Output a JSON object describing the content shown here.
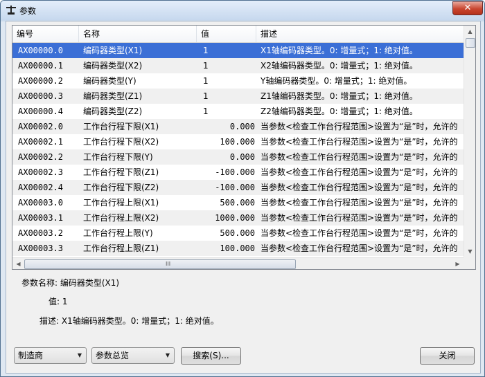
{
  "window": {
    "title": "参数",
    "close_glyph": "✕"
  },
  "table": {
    "columns": [
      "编号",
      "名称",
      "值",
      "描述"
    ],
    "rows": [
      {
        "code": "AX00000.0",
        "name": "编码器类型(X1)",
        "value": "1",
        "desc": "X1轴编码器类型。0: 增量式；1: 绝对值。",
        "align": "left",
        "state": "selected"
      },
      {
        "code": "AX00000.1",
        "name": "编码器类型(X2)",
        "value": "1",
        "desc": "X2轴编码器类型。0: 增量式；1: 绝对值。",
        "align": "left",
        "state": "normal"
      },
      {
        "code": "AX00000.2",
        "name": "编码器类型(Y)",
        "value": "1",
        "desc": "Y轴编码器类型。0: 增量式；1: 绝对值。",
        "align": "left",
        "state": "normal"
      },
      {
        "code": "AX00000.3",
        "name": "编码器类型(Z1)",
        "value": "1",
        "desc": "Z1轴编码器类型。0: 增量式；1: 绝对值。",
        "align": "left",
        "state": "normal"
      },
      {
        "code": "AX00000.4",
        "name": "编码器类型(Z2)",
        "value": "1",
        "desc": "Z2轴编码器类型。0: 增量式；1: 绝对值。",
        "align": "left",
        "state": "normal"
      },
      {
        "code": "AX00002.0",
        "name": "工作台行程下限(X1)",
        "value": "0.000",
        "desc": "当参数<检查工作台行程范围>设置为“是”时，允许的",
        "align": "right",
        "state": "normal"
      },
      {
        "code": "AX00002.1",
        "name": "工作台行程下限(X2)",
        "value": "100.000",
        "desc": "当参数<检查工作台行程范围>设置为“是”时，允许的",
        "align": "right",
        "state": "normal"
      },
      {
        "code": "AX00002.2",
        "name": "工作台行程下限(Y)",
        "value": "0.000",
        "desc": "当参数<检查工作台行程范围>设置为“是”时，允许的",
        "align": "right",
        "state": "normal"
      },
      {
        "code": "AX00002.3",
        "name": "工作台行程下限(Z1)",
        "value": "-100.000",
        "desc": "当参数<检查工作台行程范围>设置为“是”时，允许的",
        "align": "right",
        "state": "normal"
      },
      {
        "code": "AX00002.4",
        "name": "工作台行程下限(Z2)",
        "value": "-100.000",
        "desc": "当参数<检查工作台行程范围>设置为“是”时，允许的",
        "align": "right",
        "state": "normal"
      },
      {
        "code": "AX00003.0",
        "name": "工作台行程上限(X1)",
        "value": "500.000",
        "desc": "当参数<检查工作台行程范围>设置为“是”时，允许的",
        "align": "right",
        "state": "normal"
      },
      {
        "code": "AX00003.1",
        "name": "工作台行程上限(X2)",
        "value": "1000.000",
        "desc": "当参数<检查工作台行程范围>设置为“是”时，允许的",
        "align": "right",
        "state": "normal"
      },
      {
        "code": "AX00003.2",
        "name": "工作台行程上限(Y)",
        "value": "500.000",
        "desc": "当参数<检查工作台行程范围>设置为“是”时，允许的",
        "align": "right",
        "state": "normal"
      },
      {
        "code": "AX00003.3",
        "name": "工作台行程上限(Z1)",
        "value": "100.000",
        "desc": "当参数<检查工作台行程范围>设置为“是”时，允许的",
        "align": "right",
        "state": "normal"
      }
    ]
  },
  "scrollbar": {
    "grip_glyph": "III",
    "up_glyph": "▲",
    "down_glyph": "▼",
    "left_glyph": "◀",
    "right_glyph": "▶"
  },
  "detail": {
    "name_label": "参数名称:",
    "name_value": "编码器类型(X1)",
    "value_label": "值:",
    "value_value": "1",
    "desc_label": "描述:",
    "desc_value": "X1轴编码器类型。0: 增量式；1: 绝对值。"
  },
  "footer": {
    "manufacturer_select": "制造商",
    "overview_select": "参数总览",
    "dropdown_glyph": "▼",
    "search_button": "搜索(S)...",
    "close_button": "关闭"
  },
  "colors": {
    "selection": "#3b6fd6",
    "alt_row": "#f0f0f0"
  }
}
